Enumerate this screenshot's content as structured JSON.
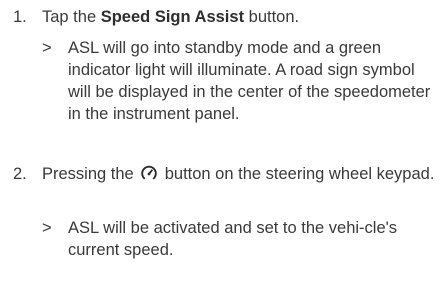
{
  "steps": [
    {
      "number": "1.",
      "text_before": "Tap the ",
      "bold": "Speed Sign Assist",
      "text_after": " button.",
      "result_marker": ">",
      "result": "ASL will go into standby mode and a green indicator light will illuminate. A road sign symbol will be displayed in the center of the speedometer in the instrument panel."
    },
    {
      "number": "2.",
      "text_before": "Pressing the",
      "icon": "speedometer-button-icon",
      "text_after": "button on the steering wheel keypad.",
      "result_marker": ">",
      "result": "ASL will be activated and set to the vehi-cle's current speed."
    }
  ]
}
